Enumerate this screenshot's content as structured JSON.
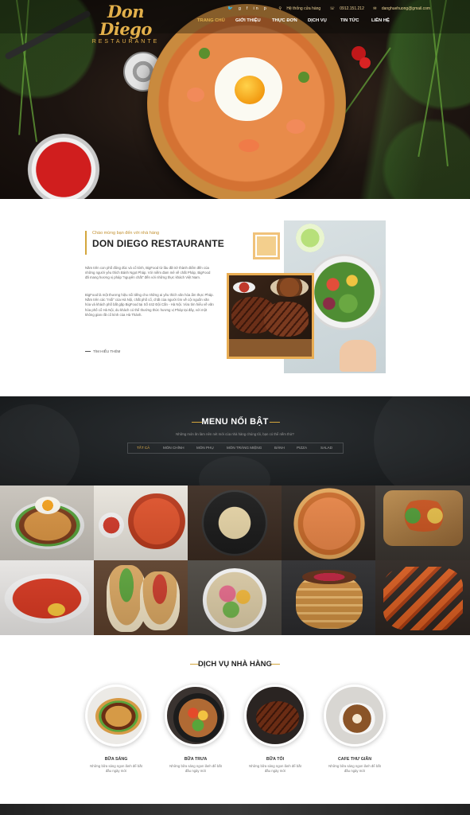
{
  "brand": {
    "logo_script": "Don Diego",
    "logo_sub": "RESTAURANTE"
  },
  "topbar": {
    "social_icons": [
      "twitter-icon",
      "google-plus-icon",
      "facebook-icon",
      "linkedin-icon",
      "pinterest-icon"
    ],
    "address": "Hệ thống cửa hàng",
    "phone": "0912.151.212",
    "email": "danghuehuong@gmail.com"
  },
  "nav": {
    "items": [
      {
        "label": "TRANG CHỦ",
        "active": true
      },
      {
        "label": "GIỚI THIỆU",
        "active": false
      },
      {
        "label": "THỰC ĐƠN",
        "active": false
      },
      {
        "label": "DỊCH VỤ",
        "active": false
      },
      {
        "label": "TIN TỨC",
        "active": false
      },
      {
        "label": "LIÊN HỆ",
        "active": false
      }
    ]
  },
  "about": {
    "eyebrow": "Chào mừng bạn đến với nhà hàng",
    "title": "DON DIEGO RESTAURANTE",
    "paragraph1": "Năm trên con phố đông đúc và cổ kính, BigFood từ lâu đã trở thành điểm đến của những người yêu thích Bánh Ngọt Pháp. Với niềm đam mê về chất Pháp, BigFood đã mang hương vị pháp \"nguyên chất\" đến với những thực khách Việt Nam.",
    "paragraph2": "BigFood là một thương hiệu nổi tiếng cho những ai yêu thích văn hóa ẩm thực Pháp. Nằm trên các \"mối\" của Hà Nội, chất phố cổ, chất của người tìm về cội nguồn văn hóa và khách phố bất gặp BigFood tại Số 442 Đội Cấn - Hà Nội. Vừa tìm hiểu về văn hóa phố cổ Hà Nội, du khách có thể thưởng thức hương vị Pháp tại đây, với một không gian rất cổ kính của Hà Thành.",
    "more": "TÌM HIỂU THÊM"
  },
  "menu": {
    "title": "MENU NỔI BẬT",
    "subtitle": "Những món ăn làm nên nét mới của nhà hàng chúng tôi, bạn có thể nếm thử?",
    "filters": [
      {
        "label": "TẤT CẢ",
        "active": true
      },
      {
        "label": "MÓN CHÍNH",
        "active": false
      },
      {
        "label": "MÓN PHỤ",
        "active": false
      },
      {
        "label": "MÓN TRÁNG MIỆNG",
        "active": false
      },
      {
        "label": "BÁNH",
        "active": false
      },
      {
        "label": "PIZZA",
        "active": false
      },
      {
        "label": "SALAD",
        "active": false
      }
    ]
  },
  "services": {
    "title": "DỊCH VỤ NHÀ HÀNG",
    "items": [
      {
        "name": "BỮA SÁNG",
        "desc": "Những bữa sáng ngon lành để bắt đầu ngày mới"
      },
      {
        "name": "BỮA TRƯA",
        "desc": "Những bữa sáng ngon lành để bắt đầu ngày mới"
      },
      {
        "name": "BỮA TỐI",
        "desc": "Những bữa sáng ngon lành để bắt đầu ngày mới"
      },
      {
        "name": "CAFE THƯ GIÃN",
        "desc": "Những bữa sáng ngon lành để bắt đầu ngày mới"
      }
    ]
  },
  "colors": {
    "accent": "#e3b04b",
    "dark": "#1c1f21",
    "text": "#333333"
  }
}
